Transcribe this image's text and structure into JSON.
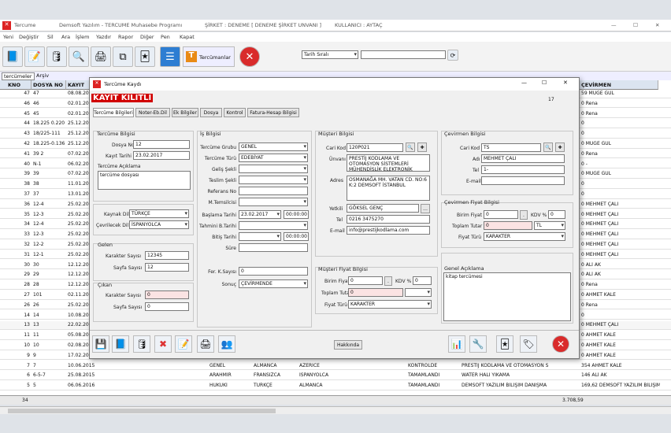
{
  "app": {
    "title": "Tercume",
    "vendor": "Demsoft Yazılım - TERCUME Muhasebe Programı",
    "company": "ŞİRKET : DENEME [ DENEME ŞİRKET UNVANI ]",
    "user": "KULLANICI : AYTAÇ"
  },
  "menu": [
    "Yeni",
    "Değiştir",
    "Sil",
    "Ara",
    "İşlem",
    "Yazdır",
    "Rapor",
    "Diğer",
    "Pen",
    "Kapat"
  ],
  "toolbar": {
    "tercumanlar": "Tercümanlar",
    "sort": "Tarih Sıralı"
  },
  "tabs": [
    "tercümeler",
    "Arşiv"
  ],
  "grid": {
    "headers": [
      "KNO",
      "DOSYA NO",
      "KAYIT",
      "ÇEVİRMEN"
    ],
    "rows": [
      {
        "kno": "47",
        "dosya": "47",
        "tarih": "08.08.20",
        "cev": "59 MÜGE GÜL"
      },
      {
        "kno": "46",
        "dosya": "46",
        "tarih": "02.01.20",
        "cev": "0 Rena"
      },
      {
        "kno": "45",
        "dosya": "45",
        "tarih": "02.01.20",
        "cev": "0 Rena"
      },
      {
        "kno": "44",
        "dosya": "18.225 0.220",
        "tarih": "25.12.20",
        "cev": "0"
      },
      {
        "kno": "43",
        "dosya": "18/225-111",
        "tarih": "25.12.20",
        "cev": "0"
      },
      {
        "kno": "42",
        "dosya": "18.225-0.136",
        "tarih": "25.12.20",
        "cev": "0 MÜGE GÜL"
      },
      {
        "kno": "41",
        "dosya": "39 2",
        "tarih": "07.02.20",
        "cev": "0 Rena"
      },
      {
        "kno": "40",
        "dosya": "N-1",
        "tarih": "06.02.20",
        "cev": "0 -"
      },
      {
        "kno": "39",
        "dosya": "39",
        "tarih": "07.02.20",
        "cev": "0 MÜGE GÜL"
      },
      {
        "kno": "38",
        "dosya": "38",
        "tarih": "11.01.20",
        "cev": "0"
      },
      {
        "kno": "37",
        "dosya": "37",
        "tarih": "13.01.20",
        "cev": "0"
      },
      {
        "kno": "36",
        "dosya": "12-4",
        "tarih": "25.02.20",
        "cev": "0 MEHMET ÇALI"
      },
      {
        "kno": "35",
        "dosya": "12-3",
        "tarih": "25.02.20",
        "cev": "0 MEHMET ÇALI"
      },
      {
        "kno": "34",
        "dosya": "12-4",
        "tarih": "25.02.20",
        "cev": "0 MEHMET ÇALI"
      },
      {
        "kno": "33",
        "dosya": "12-3",
        "tarih": "25.02.20",
        "cev": "0 MEHMET ÇALI"
      },
      {
        "kno": "32",
        "dosya": "12-2",
        "tarih": "25.02.20",
        "cev": "0 MEHMET ÇALI"
      },
      {
        "kno": "31",
        "dosya": "12-1",
        "tarih": "25.02.20",
        "cev": "0 MEHMET ÇALI"
      },
      {
        "kno": "30",
        "dosya": "30",
        "tarih": "12.12.20",
        "cev": "0 ALİ AK"
      },
      {
        "kno": "29",
        "dosya": "29",
        "tarih": "12.12.20",
        "cev": "0 ALİ AK"
      },
      {
        "kno": "28",
        "dosya": "28",
        "tarih": "12.12.20",
        "cev": "0 Rena"
      },
      {
        "kno": "27",
        "dosya": "101",
        "tarih": "02.11.20",
        "cev": "0 AHMET KALE"
      },
      {
        "kno": "26",
        "dosya": "26",
        "tarih": "25.02.20",
        "cev": "0 Rena"
      },
      {
        "kno": "14",
        "dosya": "14",
        "tarih": "10.08.20",
        "cev": "0"
      },
      {
        "kno": "13",
        "dosya": "13",
        "tarih": "22.02.20",
        "cev": "0 MEHMET ÇALI"
      },
      {
        "kno": "11",
        "dosya": "11",
        "tarih": "05.08.20",
        "cev": "0 AHMET KALE"
      },
      {
        "kno": "10",
        "dosya": "10",
        "tarih": "02.08.20",
        "cev": "0 AHMET KALE"
      },
      {
        "kno": "9",
        "dosya": "9",
        "tarih": "17.02.20",
        "cev": "0 AHMET KALE"
      },
      {
        "kno": "7",
        "dosya": "7",
        "tarih": "10.06.2015",
        "extra": [
          "GENEL",
          "ALMANCA",
          "AZERİCE",
          "KONTROLDE",
          "PRESTİJ KODLAMA VE OTOMASYON S"
        ],
        "cev": "354 AHMET KALE"
      },
      {
        "kno": "6",
        "dosya": "6-5-7",
        "tarih": "25.08.2015",
        "extra": [
          "ARAHMIR",
          "FRANSIZCA",
          "İSPANYOLCA",
          "TAMAMLANDI",
          "WATER HALI YIKAMA"
        ],
        "cev": "146 ALİ AK"
      },
      {
        "kno": "5",
        "dosya": "5",
        "tarih": "06.06.2016",
        "extra": [
          "HUKUKİ",
          "TÜRKÇE",
          "ALMANCA",
          "TAMAMLANDI",
          "DEMSOFT YAZILIM BİLİŞİM DANIŞMA"
        ],
        "cev": "169,62 DEMSOFT YAZILIM BİLİŞİM"
      }
    ],
    "footer_count": "34",
    "footer_total": "3.708,59"
  },
  "dialog": {
    "title": "Tercüme Kaydı",
    "locked": "KAYIT KİLİTLİ",
    "rec": "17",
    "tabs": [
      "Tercüme Bilgileri",
      "Noter-Eb.Dil",
      "Ek Bilgiler",
      "Dosya",
      "Kontrol",
      "Fatura-Hesap Bilgisi"
    ],
    "tercume": {
      "title": "Tercüme Bilgisi",
      "dosya_no_l": "Dosya No",
      "dosya_no": "12",
      "kayit_l": "Kayıt Tarihi",
      "kayit": "23.02.2017",
      "aciklama_l": "Tercüme Açıklama",
      "aciklama": "tercüme dosyası",
      "kaynak_l": "Kaynak Dil",
      "kaynak": "TÜRKÇE",
      "ceviri_l": "Çevrilecek Dil",
      "ceviri": "İSPANYOLCA"
    },
    "gelen": {
      "title": "Gelen",
      "ks_l": "Karakter Sayısı",
      "ks": "12345",
      "ss_l": "Sayfa Sayısı",
      "ss": "12"
    },
    "cikan": {
      "title": "Çıkan",
      "ks_l": "Karakter Sayısı",
      "ks": "0",
      "ss_l": "Sayfa Sayısı",
      "ss": "0"
    },
    "is": {
      "title": "İş Bilgisi",
      "grup_l": "Tercüme Grubu",
      "grup": "GENEL",
      "turu_l": "Tercüme Türü",
      "turu": "EDEBİYAT",
      "gelis_l": "Geliş Şekli",
      "teslim_l": "Teslim Şekli",
      "referans_l": "Referans No",
      "temsilci_l": "M.Temsilcisi",
      "bas_l": "Başlama Tarihi",
      "bas": "23.02.2017",
      "bas_s": "00:00:00",
      "tah_l": "Tahmini B.Tarihi",
      "bitis_l": "Bitiş Tarihi",
      "bitis_s": "00:00:00",
      "sure_l": "Süre",
      "fer_l": "Fer. K.Sayısı",
      "fer": "0",
      "sonuc_l": "Sonuç",
      "sonuc": "ÇEVİRMENDE"
    },
    "musteri": {
      "title": "Müşteri Bilgisi",
      "cari_l": "Cari Kod",
      "cari": "120P021",
      "unvan_l": "Ünvanı",
      "unvan": "PRESTİJ KODLAMA VE OTOMASYON SİSTEMLERİ MÜHENDİSLİK ELEKTRONİK SANAYİ TİCARET LİMİTED ŞİRKETİ",
      "adres_l": "Adres",
      "adres": "OSMANAĞA MH. VATAN CD. NO:6 K:2 DEMSOFT İSTANBUL",
      "yetkili_l": "Yetkili",
      "yetkili": "GÖKSEL GENÇ",
      "tel_l": "Tel",
      "tel": "0216 3475270",
      "email_l": "E-mail",
      "email": "info@prestijkodlama.com"
    },
    "mfiyat": {
      "title": "Müşteri Fiyat Bilgisi",
      "birim_l": "Birim Fiyat",
      "birim": "0",
      "kdv_l": "KDV %",
      "kdv": "0",
      "toplam_l": "Toplam Tutar",
      "toplam": "0",
      "tur_l": "Fiyat Türü",
      "tur": "KARAKTER"
    },
    "cevirmen": {
      "title": "Çevirmen Bilgisi",
      "cari_l": "Cari Kod",
      "cari": "TS",
      "adi_l": "Adı",
      "adi": "MEHMET ÇALI",
      "tel_l": "Tel",
      "tel": "1-",
      "email_l": "E-mail"
    },
    "cfiyat": {
      "title": "Çevirmen Fiyat Bilgisi",
      "birim_l": "Birim Fiyat",
      "birim": "0",
      "kdv_l": "KDV %",
      "kdv": "0",
      "toplam_l": "Toplam Tutar",
      "toplam": "0",
      "tl": "TL",
      "tur_l": "Fiyat Türü",
      "tur": "KARAKTER"
    },
    "genel": {
      "title": "Genel Açıklama",
      "text": "kitap tercümesi"
    },
    "hakkinda": "Hakkında"
  }
}
